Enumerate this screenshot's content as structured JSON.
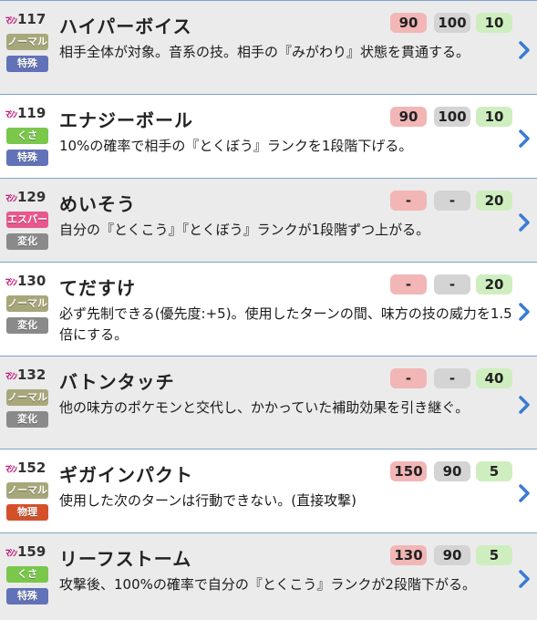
{
  "machine_prefix": "ﾏｼﾝ",
  "colors": {
    "normal": "#a8a77a",
    "grass": "#7ac74c",
    "psychic": "#e8578e",
    "special": "#6272b8",
    "status": "#8a8a8a",
    "physical": "#d4502a",
    "chevron": "#3a7bd5"
  },
  "moves": [
    {
      "number": "117",
      "name": "ハイパーボイス",
      "type": "ノーマル",
      "type_color": "normal",
      "category": "特殊",
      "category_color": "special",
      "power": "90",
      "accuracy": "100",
      "pp": "10",
      "description": "相手全体が対象。音系の技。相手の『みがわり』状態を貫通する。"
    },
    {
      "number": "119",
      "name": "エナジーボール",
      "type": "くさ",
      "type_color": "grass",
      "category": "特殊",
      "category_color": "special",
      "power": "90",
      "accuracy": "100",
      "pp": "10",
      "description": "10%の確率で相手の『とくぼう』ランクを1段階下げる。"
    },
    {
      "number": "129",
      "name": "めいそう",
      "type": "エスパー",
      "type_color": "psychic",
      "category": "変化",
      "category_color": "status",
      "power": "-",
      "accuracy": "-",
      "pp": "20",
      "description": "自分の『とくこう』『とくぼう』ランクが1段階ずつ上がる。"
    },
    {
      "number": "130",
      "name": "てだすけ",
      "type": "ノーマル",
      "type_color": "normal",
      "category": "変化",
      "category_color": "status",
      "power": "-",
      "accuracy": "-",
      "pp": "20",
      "description": "必ず先制できる(優先度:+5)。使用したターンの間、味方の技の威力を1.5倍にする。"
    },
    {
      "number": "132",
      "name": "バトンタッチ",
      "type": "ノーマル",
      "type_color": "normal",
      "category": "変化",
      "category_color": "status",
      "power": "-",
      "accuracy": "-",
      "pp": "40",
      "description": "他の味方のポケモンと交代し、かかっていた補助効果を引き継ぐ。"
    },
    {
      "number": "152",
      "name": "ギガインパクト",
      "type": "ノーマル",
      "type_color": "normal",
      "category": "物理",
      "category_color": "physical",
      "power": "150",
      "accuracy": "90",
      "pp": "5",
      "description": "使用した次のターンは行動できない。(直接攻撃)"
    },
    {
      "number": "159",
      "name": "リーフストーム",
      "type": "くさ",
      "type_color": "grass",
      "category": "特殊",
      "category_color": "special",
      "power": "130",
      "accuracy": "90",
      "pp": "5",
      "description": "攻撃後、100%の確率で自分の『とくこう』ランクが2段階下がる。"
    }
  ]
}
